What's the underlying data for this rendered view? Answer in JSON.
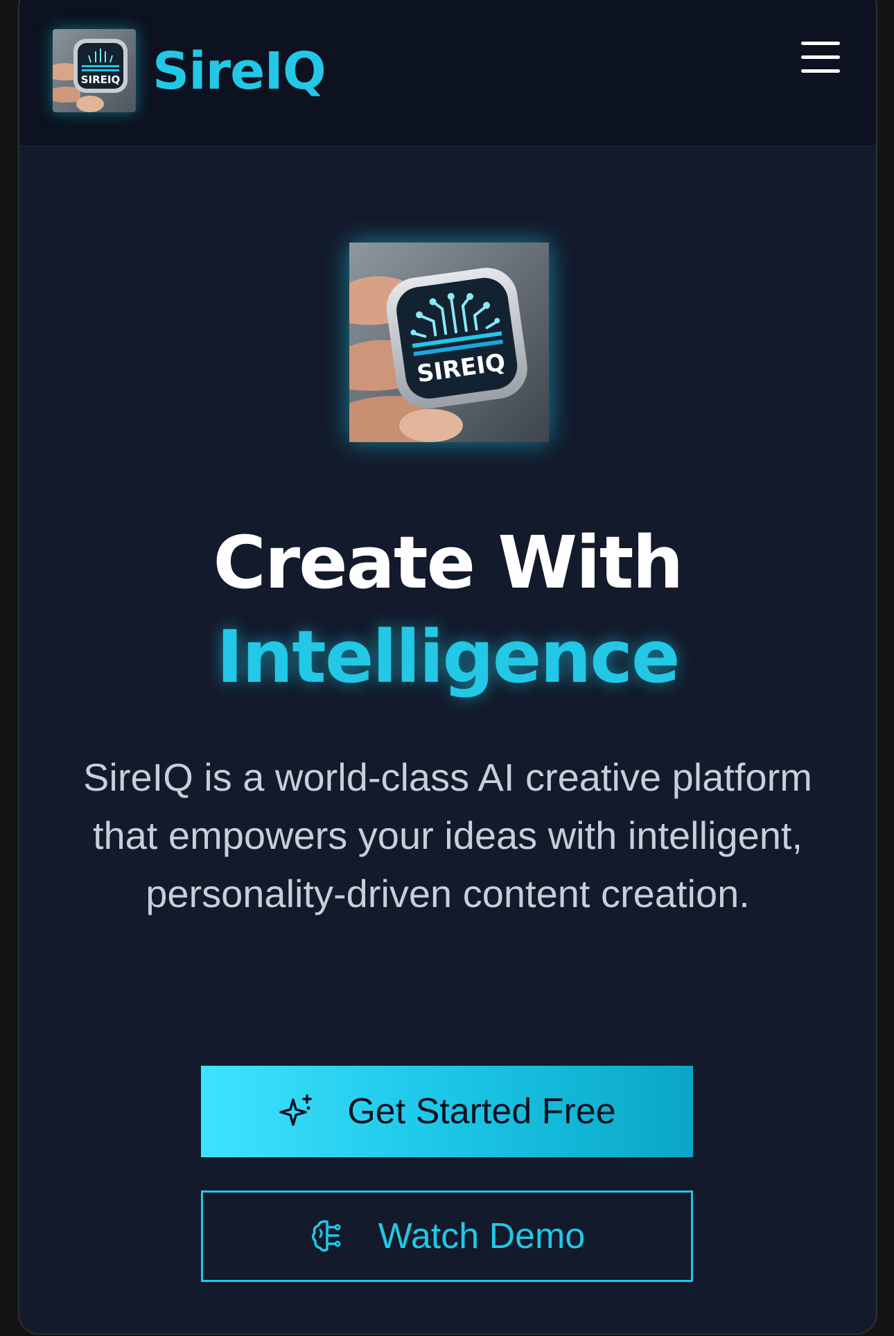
{
  "navbar": {
    "brand_name": "SireIQ",
    "logo_icon": "sireiq-logo-icon",
    "menu_icon": "hamburger-menu-icon"
  },
  "hero": {
    "logo_icon": "sireiq-logo-icon",
    "logo_text": "SIREIQ",
    "headline_line1": "Create With",
    "headline_line2": "Intelligence",
    "description": "SireIQ is a world-class AI creative platform that empowers your ideas with intelligent, personality-driven content creation."
  },
  "buttons": {
    "primary_label": "Get Started Free",
    "primary_icon": "sparkle-icon",
    "secondary_label": "Watch Demo",
    "secondary_icon": "brain-icon"
  },
  "colors": {
    "accent": "#22c8e5",
    "background": "#121a2b",
    "navbar_background": "#0c121f",
    "text_primary": "#ffffff",
    "text_secondary": "#c9ced8"
  }
}
